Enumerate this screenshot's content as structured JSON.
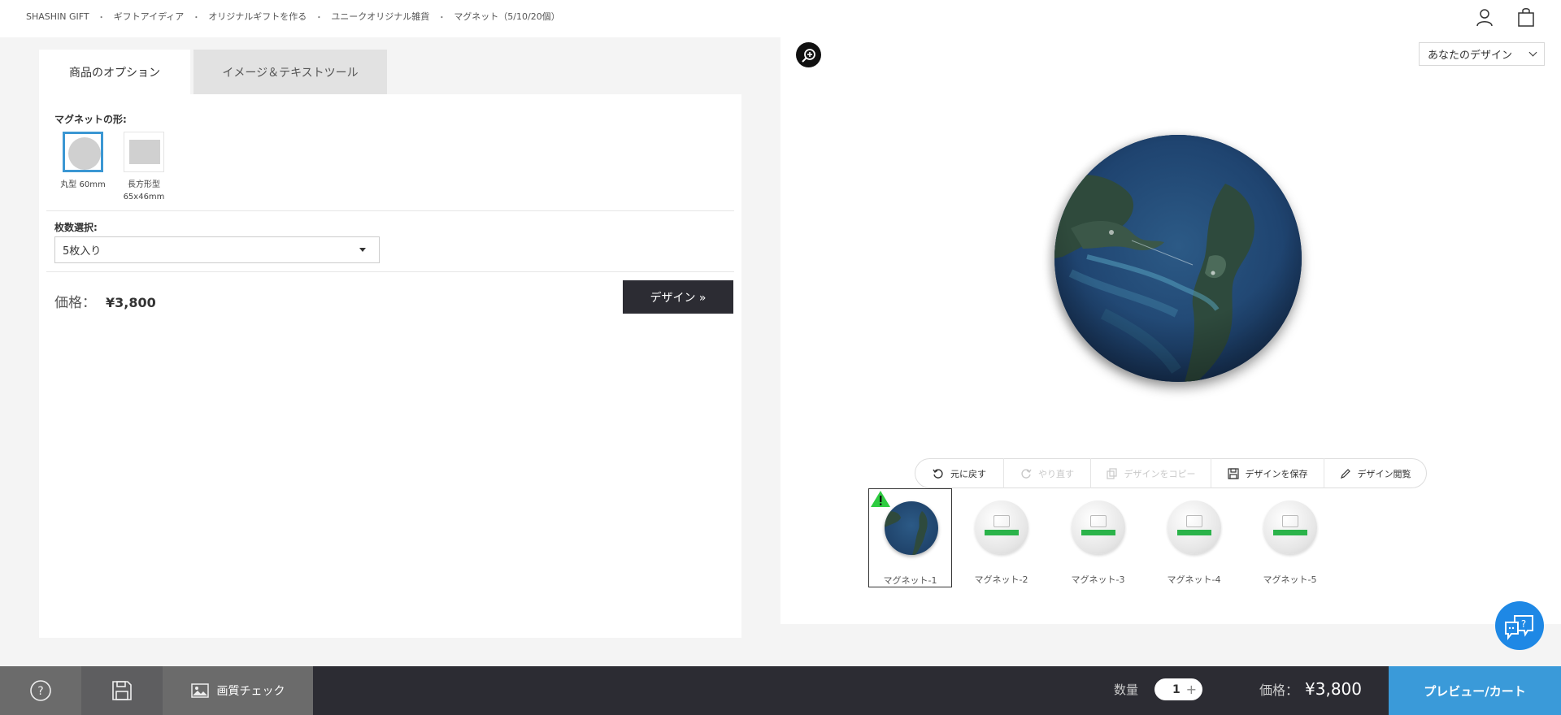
{
  "breadcrumb": [
    "SHASHIN GIFT",
    "ギフトアイディア",
    "オリジナルギフトを作る",
    "ユニークオリジナル雑貨",
    "マグネット（5/10/20個）"
  ],
  "breadcrumb_separator": "・",
  "header_icons": [
    "user-icon",
    "shopping-bag-icon"
  ],
  "tabs": [
    {
      "label": "商品のオプション",
      "active": true
    },
    {
      "label": "イメージ＆テキストツール",
      "active": false
    }
  ],
  "options": {
    "shape_label": "マグネットの形:",
    "shapes": [
      {
        "caption": "丸型 60mm",
        "selected": true
      },
      {
        "caption": "長方形型\n65x46mm",
        "selected": false
      }
    ],
    "quantity_label": "枚数選択:",
    "quantity_value": "5枚入り",
    "price_label": "価格：",
    "price_value": "¥3,800",
    "design_button": "デザイン »"
  },
  "preview": {
    "view_select": "あなたのデザイン",
    "toolbar": [
      {
        "label": "元に戻す",
        "icon": "undo-icon",
        "enabled": true
      },
      {
        "label": "やり直す",
        "icon": "redo-icon",
        "enabled": false
      },
      {
        "label": "デザインをコピー",
        "icon": "copy-icon",
        "enabled": false
      },
      {
        "label": "デザインを保存",
        "icon": "save-icon",
        "enabled": true
      },
      {
        "label": "デザイン閲覧",
        "icon": "pencil-icon",
        "enabled": true
      }
    ],
    "thumbnails": [
      {
        "label": "マグネット-1",
        "selected": true,
        "has_image": true,
        "warning": true
      },
      {
        "label": "マグネット-2",
        "selected": false,
        "has_image": false
      },
      {
        "label": "マグネット-3",
        "selected": false,
        "has_image": false
      },
      {
        "label": "マグネット-4",
        "selected": false,
        "has_image": false
      },
      {
        "label": "マグネット-5",
        "selected": false,
        "has_image": false
      }
    ]
  },
  "bottom_bar": {
    "quality_check": "画質チェック",
    "quantity_label": "数量",
    "quantity_value": "1",
    "price_label": "価格：",
    "price_value": "¥3,800",
    "cart_button": "プレビュー/カート"
  },
  "colors": {
    "accent_blue": "#3a9ad9",
    "dark": "#2c2c33",
    "warning_green": "#2ecc40",
    "placeholder_green": "#2bb34a"
  }
}
